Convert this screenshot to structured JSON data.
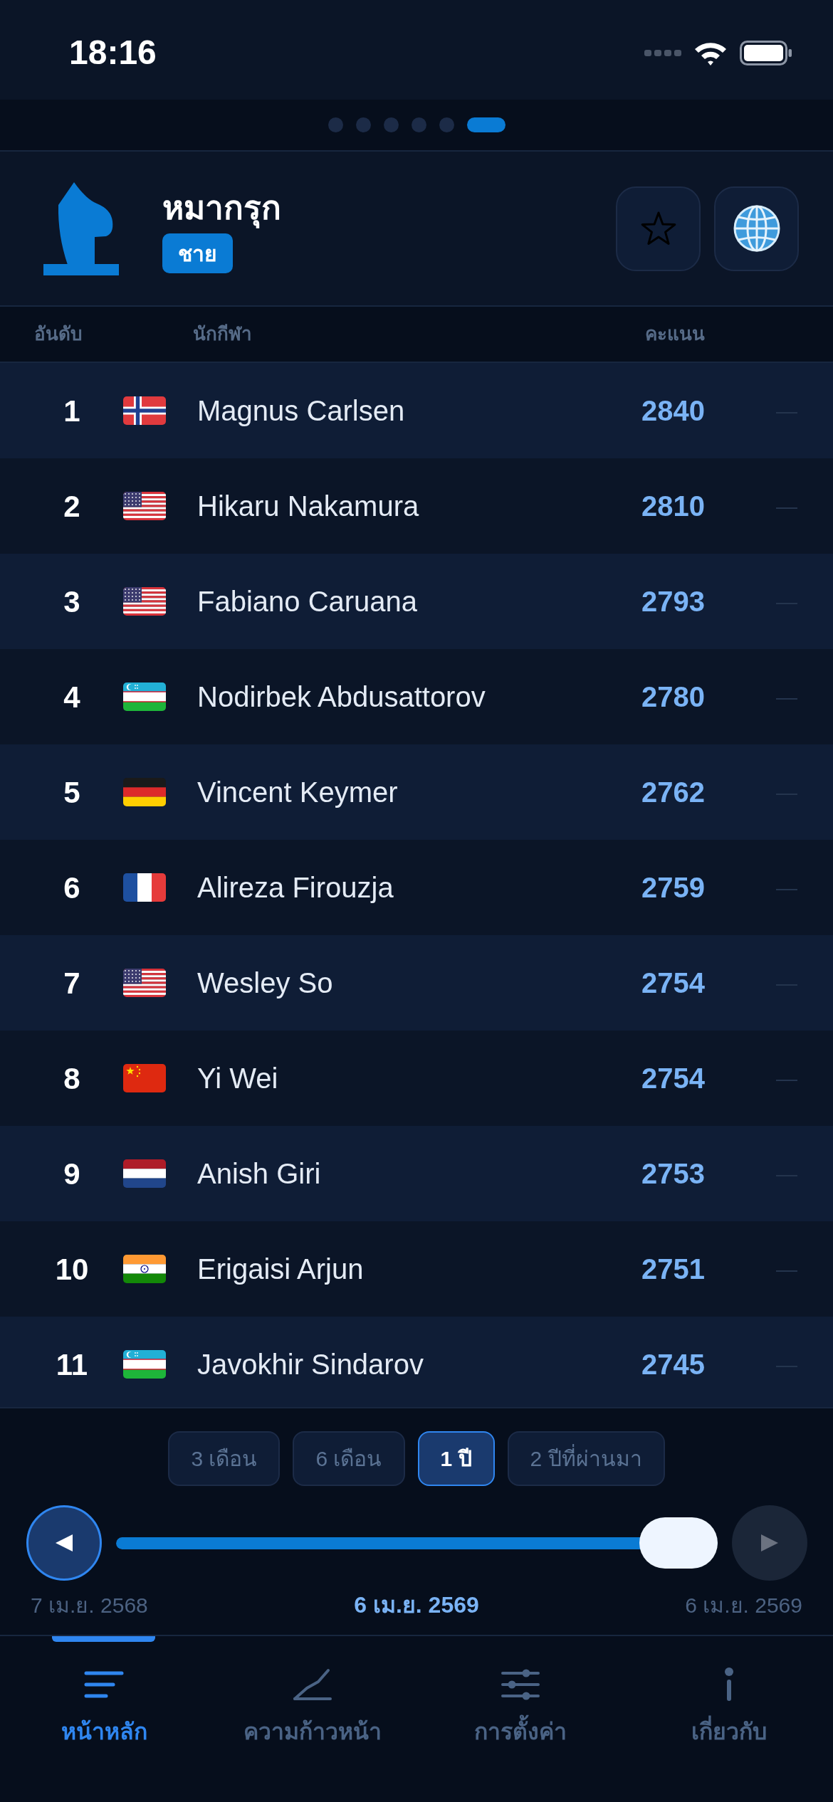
{
  "status_bar": {
    "time": "18:16"
  },
  "page_indicator": {
    "dots": [
      {
        "selected": false
      },
      {
        "selected": false
      },
      {
        "selected": false
      },
      {
        "selected": false
      },
      {
        "selected": false
      },
      {
        "selected": true
      }
    ]
  },
  "header": {
    "title": "หมากรุก",
    "badge": "ชาย"
  },
  "table": {
    "columns": [
      "อันดับ",
      "นักกีฬา",
      "คะแนน"
    ],
    "rows": [
      {
        "rank": "1",
        "kind": "norway",
        "name": "Magnus Carlsen",
        "rating": "2840",
        "column_4": "—"
      },
      {
        "rank": "2",
        "kind": "usa",
        "name": "Hikaru Nakamura",
        "rating": "2810",
        "column_4": "—"
      },
      {
        "rank": "3",
        "kind": "usa",
        "name": "Fabiano Caruana",
        "rating": "2793",
        "column_4": "—"
      },
      {
        "rank": "4",
        "kind": "uzbekistan",
        "name": "Nodirbek Abdusattorov",
        "rating": "2780",
        "column_4": "—"
      },
      {
        "rank": "5",
        "kind": "germany",
        "name": "Vincent Keymer",
        "rating": "2762",
        "column_4": "—"
      },
      {
        "rank": "6",
        "kind": "france",
        "name": "Alireza Firouzja",
        "rating": "2759",
        "column_4": "—"
      },
      {
        "rank": "7",
        "kind": "usa",
        "name": "Wesley So",
        "rating": "2754",
        "column_4": "—"
      },
      {
        "rank": "8",
        "kind": "china",
        "name": "Yi Wei",
        "rating": "2754",
        "column_4": "—"
      },
      {
        "rank": "9",
        "kind": "netherlands",
        "name": "Anish Giri",
        "rating": "2753",
        "column_4": "—"
      },
      {
        "rank": "10",
        "kind": "india",
        "name": "Erigaisi Arjun",
        "rating": "2751",
        "column_4": "—"
      },
      {
        "rank": "11",
        "kind": "uzbekistan",
        "name": "Javokhir Sindarov",
        "rating": "2745",
        "column_4": "—"
      }
    ]
  },
  "periods": [
    {
      "label": "3 เดือน",
      "selected": false
    },
    {
      "label": "6 เดือน",
      "selected": false
    },
    {
      "label": "1 ปี",
      "selected": true
    },
    {
      "label": "2 ปีที่ผ่านมา",
      "selected": false
    }
  ],
  "timeline": {
    "previous_button": {
      "disabled": false
    },
    "next_button": {
      "disabled": true
    },
    "level": 1,
    "start_date": "7 เม.ย. 2568",
    "current_date": "6 เม.ย. 2569",
    "end_date": "6 เม.ย. 2569"
  },
  "tab_bar": {
    "tabs": [
      {
        "label": "หน้าหลัก",
        "kind": "home",
        "selected": true
      },
      {
        "label": "ความก้าวหน้า",
        "kind": "progress",
        "selected": false
      },
      {
        "label": "การตั้งค่า",
        "kind": "settings",
        "selected": false
      },
      {
        "label": "เกี่ยวกับ",
        "kind": "about",
        "selected": false
      }
    ]
  }
}
